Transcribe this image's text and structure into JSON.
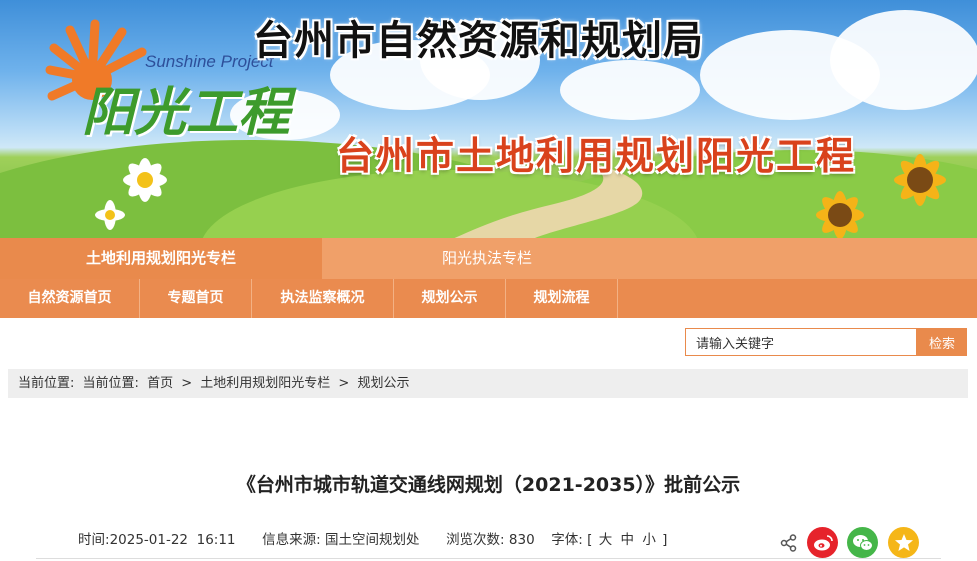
{
  "header": {
    "site_title": "台州市自然资源和规划局",
    "logo_en": "Sunshine Project",
    "logo_cn": "阳光工程",
    "banner_subtitle": "台州市土地利用规划阳光工程"
  },
  "nav_primary": [
    {
      "label": "土地利用规划阳光专栏",
      "active": true
    },
    {
      "label": "阳光执法专栏",
      "active": false
    }
  ],
  "nav_secondary": [
    {
      "label": "自然资源首页"
    },
    {
      "label": "专题首页"
    },
    {
      "label": "执法监察概况"
    },
    {
      "label": "规划公示"
    },
    {
      "label": "规划流程"
    }
  ],
  "search": {
    "placeholder": "请输入关键字",
    "value": "请输入关键字",
    "button_label": "检索"
  },
  "breadcrumb": {
    "prefix": "当前位置:",
    "prefix2": "当前位置:",
    "items": [
      "首页",
      "土地利用规划阳光专栏",
      "规划公示"
    ],
    "separator": ">"
  },
  "article": {
    "title": "《台州市城市轨道交通线网规划（2021-2035）》批前公示",
    "time_label": "时间:",
    "time_value": "2025-01-22  16:11",
    "source_label": "信息来源:",
    "source_value": "国土空间规划处",
    "views_label": "浏览次数:",
    "views_value": "830",
    "font_label": "字体:",
    "font_open": "[",
    "font_large": "大",
    "font_medium": "中",
    "font_small": "小",
    "font_close": "]"
  },
  "share": {
    "icons": [
      "share-icon",
      "weibo-icon",
      "wechat-icon",
      "favorite-icon"
    ]
  },
  "colors": {
    "accent": "#e98a4c",
    "nav_light": "#f0a069",
    "weibo": "#e6232b",
    "wechat": "#45b649",
    "favorite": "#f5b618"
  }
}
